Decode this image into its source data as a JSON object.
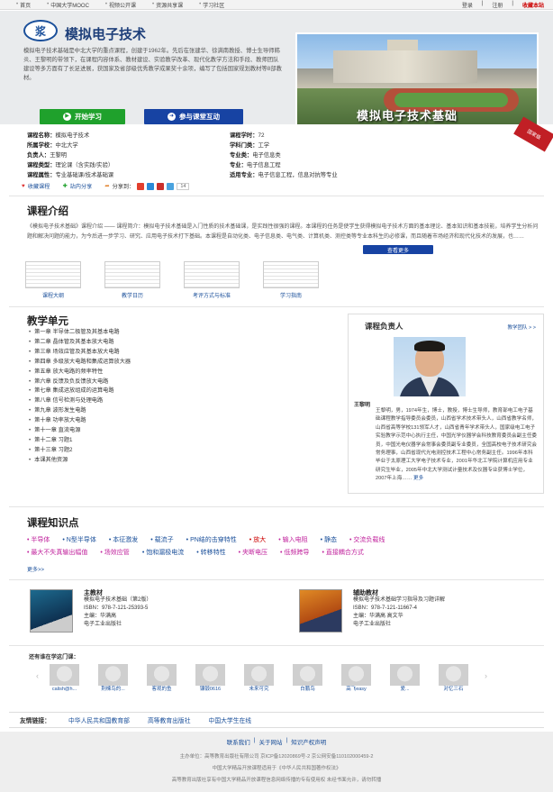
{
  "topnav": {
    "items": [
      "首页",
      "中国大学MOOC",
      "视频公开课",
      "资源共享课",
      "学习社区"
    ],
    "login": "登录",
    "register": "注册",
    "hotline": "收藏本站"
  },
  "hero": {
    "logo_text": "浆",
    "title": "模拟电子技术",
    "description": "模拟电子技术基础是中北大学的重点课程，创建于1962年。先后在张建华、徐满南教授、博士生导师韩炎、王黎明的带领下，在课程内容体系、教材建设、实验教学改革、现代化教学方法和手段、教师团队建设等多方面有了长足进展，获国家及省部级优秀教学成果奖十余项，编写了包括国家规划教材等8部教材。",
    "start_btn": "开始学习",
    "join_btn": "参与课堂互动",
    "photo_caption": "模拟电子技术基础"
  },
  "info": {
    "course_name_k": "课程名称：",
    "course_name_v": "模拟电子技术",
    "hours_k": "课程学时：",
    "hours_v": "72",
    "school_k": "所属学校：",
    "school_v": "中北大学",
    "category_k": "学科门类：",
    "category_v": "工学",
    "leader_k": "负责人：",
    "leader_v": "王黎明",
    "cls_k": "专业类：",
    "cls_v": "电子信息类",
    "type_k": "课程类型：",
    "type_v": "理论课（含实践/实验）",
    "major_k": "专业：",
    "major_v": "电子信息工程",
    "attr_k": "课程属性：",
    "attr_v": "专业基础课/技术基础课",
    "fit_k": "适用专业：",
    "fit_v": "电子信息工程，信息对抗等专业",
    "badge": "国家级"
  },
  "share": {
    "favorite": "收藏课程",
    "site_share": "站内分享",
    "share_to": "分享到：",
    "count": "14"
  },
  "intro": {
    "heading": "课程介绍",
    "text": "《模拟电子技术基础》课程介绍 —— 课程简介：模拟电子技术基础是入门性质的技术基础课，是实践性很强的课程。本课程的任务是使学生获得模拟电子技术方面的基本理论、基本知识和基本技能，培养学生分析问题和解决问题的能力，为今后进一步学习、研究、应用电子技术打下基础。本课程是自动化类、电子信息类、电气类、计算机类、测控类等专业本科生的必修课，而且随着市场经济和现代化技术的发展，也……",
    "more": "查看更多",
    "docs": [
      "课程大纲",
      "教学日历",
      "考评方式与标准",
      "学习指南"
    ]
  },
  "units": {
    "heading": "教学单元",
    "items": [
      "第一章  半导体二极管及其基本电路",
      "第二章  晶体管及其基本放大电路",
      "第三章  场效应管及其基本放大电路",
      "第四章  多级放大电路和集成运算放大器",
      "第五章  放大电路的频率特性",
      "第六章  反馈及负反馈放大电路",
      "第七章  集成运放组成的运算电路",
      "第八章  信号检测与处理电路",
      "第九章  波形发生电路",
      "第十章  功率放大电路",
      "第十一章  直流电源",
      "第十二章  习题1",
      "第十三章  习题2",
      "本课其他资源"
    ]
  },
  "teacher": {
    "heading": "课程负责人",
    "team_link": "教学团队 > >",
    "name": "王黎明",
    "bio": "王黎明，男，1974年生，博士，教授，博士生导师，教育部电工电子基础课程教学指导委员会委员，山西省学术技术带头人，山西省教学名师，山西省高等学校131领军人才，山西省青年学术带头人，国家级电工电子实验教学示范中心执行主任，中国光学仪器学会科技教育委员会副主任委员，中国光电仪器学会常事会委员副专业委员，全国高校电子技术研究会常务理事，山西省现代光电测控技术工程中心常务副主任。1996年本科毕业于太原理工大学电子技术专业，2001年华北工学院计算机应用专业研究生毕业，2005年中北大学测试计量技术及仪器专业获博士学位，2007年上海……",
    "more": "更多"
  },
  "knowledge": {
    "heading": "课程知识点",
    "line1": [
      "半导体",
      "N型半导体",
      "本征激发",
      "载流子",
      "PN结的击穿特性",
      "放大",
      "输入电阻",
      "静态",
      "交流负载线"
    ],
    "line2": [
      "最大不失真输出幅值",
      "场效应管",
      "饱和漏极电流",
      "转移特性",
      "夹断电压",
      "低频跨导",
      "直接耦合方式"
    ],
    "more": "更多>>",
    "colors1": [
      "#c0219c",
      "#1a4f9a",
      "#1a4f9a",
      "#1a4f9a",
      "#1a4f9a",
      "#c00",
      "#c0219c",
      "#1a4f9a",
      "#c0219c"
    ],
    "colors2": [
      "#c0219c",
      "#c0219c",
      "#1a4f9a",
      "#1a4f9a",
      "#c0219c",
      "#c0219c",
      "#c0219c"
    ]
  },
  "books": {
    "main": {
      "tag": "主教材",
      "title": "模拟电子技术基础（第2版）",
      "isbn": "ISBN：978-7-121-25393-5",
      "editor": "主编：华满高",
      "publisher": "电子工业出版社"
    },
    "aux": {
      "tag": "辅助教材",
      "title": "模拟电子技术基础学习指导及习题详解",
      "isbn": "ISBN：978-7-121-11667-4",
      "editor": "主编：华满高  高文华",
      "publisher": "电子工业出版社"
    }
  },
  "others": {
    "label": "还有谁在学这门课：",
    "names": [
      "calish@h...",
      "荆楝鸟的...",
      "客观的鱼",
      "镰锻0616",
      "未来可究",
      "白鹏鸟",
      "高飞easy",
      "爱...",
      "对忆三石"
    ]
  },
  "friends": {
    "title": "友情链接：",
    "links": [
      "中华人民共和国教育部",
      "高等教育出版社",
      "中国大学生在线"
    ]
  },
  "footer": {
    "links": [
      "联系我们",
      "|",
      "关于网站",
      "|",
      "知识产权声明"
    ],
    "line1": "主办单位：高等教育出版社有限公司        京ICP备12020869号-2        京公网安备110102000459-2",
    "line2": "中国大学精品开放课程适用于《中华人民共和国著作权法》",
    "line3": "高等教育出版社享有中国大学精品开放课程信息网络传播的专有使用权 未经书面允许，请勿转播"
  }
}
